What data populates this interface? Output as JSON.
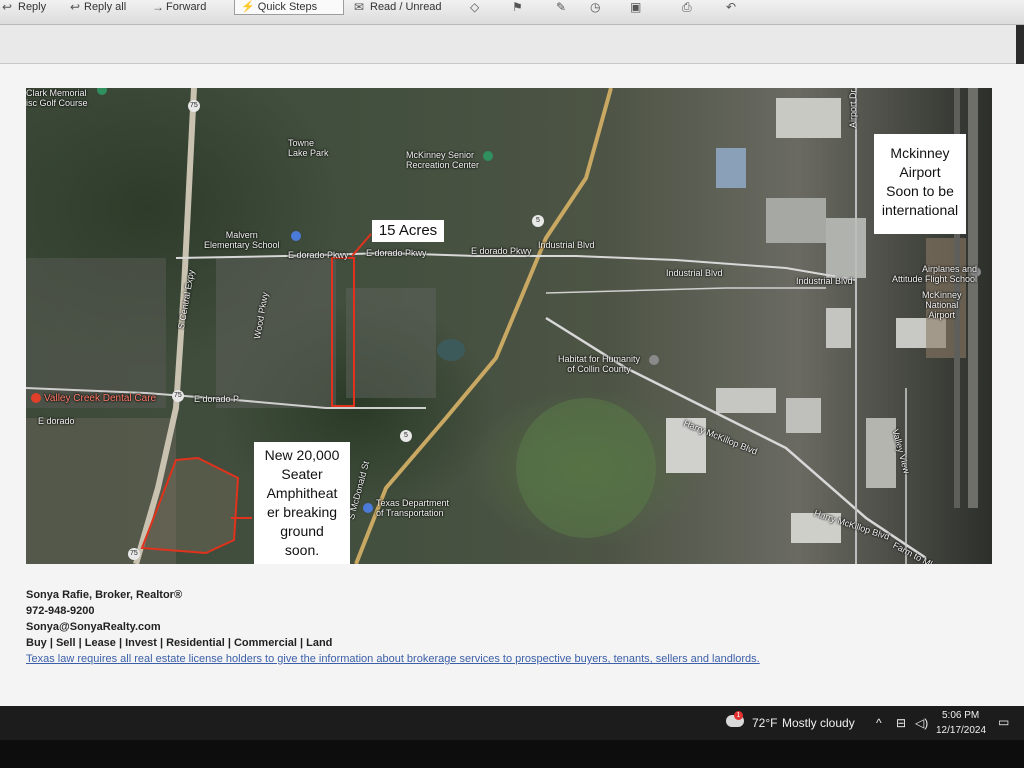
{
  "ribbon": {
    "reply": "Reply",
    "reply_all": "Reply all",
    "forward": "Forward",
    "quick_steps": "Quick Steps",
    "read_unread": "Read / Unread"
  },
  "map": {
    "callouts": {
      "acres": "15 Acres",
      "airport_1": "Mckinney",
      "airport_2": "Airport",
      "airport_3": "Soon to be",
      "airport_4": "international",
      "amph_1": "New 20,000",
      "amph_2": "Seater",
      "amph_3": "Amphitheat",
      "amph_4": "er breaking",
      "amph_5": "ground",
      "amph_6": "soon."
    },
    "labels": {
      "golf_1": "Clark Memorial",
      "golf_2": "isc Golf Course",
      "towne_1": "Towne",
      "towne_2": "Lake Park",
      "senior_1": "McKinney Senior",
      "senior_2": "Recreation Center",
      "malvern_1": "Malvern",
      "malvern_2": "Elementary School",
      "eldorado_1": "E dorado Pkwy",
      "eldorado_2": "E dorado Pkwy",
      "eldorado_3": "E dorado Pkwy",
      "eldorado_4": "E dorado",
      "eldorado_5": "E dorado P",
      "industrial_1": "Industrial Blvd",
      "industrial_2": "Industrial Blvd",
      "industrial_3": "Industrial Blvd",
      "airport_dr": "Airport Dr",
      "flight_1": "Airplanes and",
      "flight_2": "Attitude Flight School",
      "mckinney_ap_1": "McKinney",
      "mckinney_ap_2": "National",
      "mckinney_ap_3": "Airport",
      "habitat_1": "Habitat for Humanity",
      "habitat_2": "of Collin County",
      "valley_creek": "Valley Creek Dental Care",
      "hmk_1": "Harry McKillop Blvd",
      "hmk_2": "Harry McKillop Blvd",
      "farm": "Farm to Mk",
      "txdot_1": "Texas Department",
      "txdot_2": "of Transportation",
      "mcdonald": "S McDonald St",
      "central": "S Central Expy",
      "wood": "Wood Pkwy",
      "valley_view": "Valley View",
      "hwy75_a": "75",
      "hwy75_b": "75",
      "hwy75_c": "75",
      "hwy5_a": "5",
      "hwy5_b": "5"
    }
  },
  "signature": {
    "name": "Sonya Rafie, Broker,  Realtor®",
    "phone": "972-948-9200",
    "email": "Sonya@SonyaRealty.com",
    "services": "Buy | Sell | Lease | Invest | Residential | Commercial | Land",
    "legal": "Texas law requires all real estate license holders to give the information about brokerage services to prospective buyers, tenants, sellers and landlords."
  },
  "taskbar": {
    "weather_temp": "72°F",
    "weather_desc": "Mostly cloudy",
    "notification_count": "1",
    "time": "5:06 PM",
    "date": "12/17/2024"
  }
}
